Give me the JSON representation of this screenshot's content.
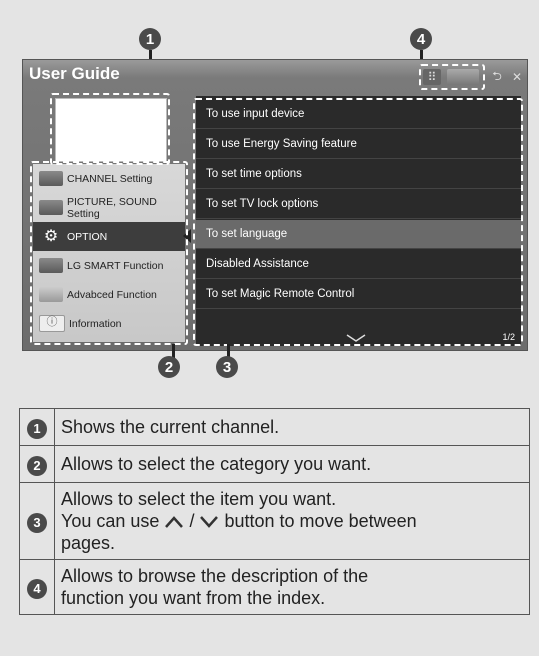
{
  "callouts": [
    "1",
    "2",
    "3",
    "4"
  ],
  "screen": {
    "title": "User Guide",
    "top_buttons": [
      {
        "name": "index-button",
        "glyph": "⠿"
      },
      {
        "name": "folder-button",
        "glyph": ""
      },
      {
        "name": "back-button",
        "glyph": "⮌"
      },
      {
        "name": "close-button",
        "glyph": "✕"
      }
    ],
    "categories": [
      {
        "label": "CHANNEL Setting",
        "icon": "channel-icon"
      },
      {
        "label": "PICTURE, SOUND Setting",
        "icon": "picture-sound-icon"
      },
      {
        "label": "OPTION",
        "icon": "gear-icon",
        "active": true
      },
      {
        "label": "LG SMART Function",
        "icon": "smart-icon"
      },
      {
        "label": "Advabced Function",
        "icon": "advanced-icon"
      },
      {
        "label": "Information",
        "icon": "info-icon"
      }
    ],
    "items": [
      {
        "label": "To use input device"
      },
      {
        "label": "To use Energy Saving feature"
      },
      {
        "label": "To set time options"
      },
      {
        "label": "To set TV lock options"
      },
      {
        "label": "To set language",
        "active": true
      },
      {
        "label": "Disabled Assistance"
      },
      {
        "label": "To set Magic Remote Control"
      }
    ],
    "page_indicator": "1/2"
  },
  "legend": [
    {
      "num": "1",
      "text": "Shows the current channel."
    },
    {
      "num": "2",
      "text": "Allows to select the category you want."
    },
    {
      "num": "3",
      "text_line1": "Allows to select the item you want.",
      "text_line2_pre": "You can use",
      "text_line2_post": "button to move between",
      "text_line3": "pages."
    },
    {
      "num": "4",
      "text_line1": "Allows to browse the description of the",
      "text_line2": "function you want from the index."
    }
  ]
}
